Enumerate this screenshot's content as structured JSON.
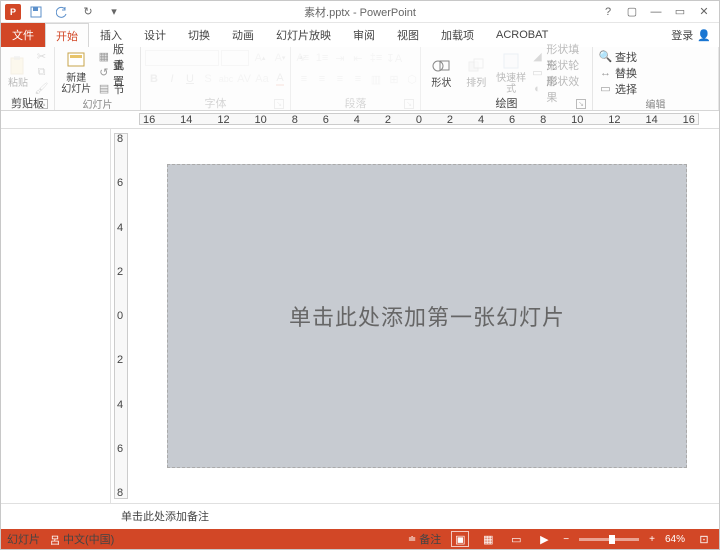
{
  "titlebar": {
    "title": "素材.pptx - PowerPoint"
  },
  "tabs": {
    "file": "文件",
    "items": [
      "开始",
      "插入",
      "设计",
      "切换",
      "动画",
      "幻灯片放映",
      "审阅",
      "视图",
      "加载项",
      "ACROBAT"
    ],
    "active": 0,
    "login": "登录"
  },
  "ribbon": {
    "clipboard": {
      "paste": "粘贴",
      "format": "格式刷",
      "label": "剪贴板"
    },
    "slides": {
      "new": "新建\n幻灯片",
      "layout": "版式",
      "reset": "重置",
      "section": "节",
      "label": "幻灯片"
    },
    "font": {
      "label": "字体"
    },
    "paragraph": {
      "label": "段落"
    },
    "drawing": {
      "shapes": "形状",
      "arrange": "排列",
      "quickstyle": "快速样式",
      "fill": "形状填充",
      "outline": "形状轮廓",
      "effects": "形状效果",
      "label": "绘图"
    },
    "editing": {
      "find": "查找",
      "replace": "替换",
      "select": "选择",
      "label": "编辑"
    }
  },
  "ruler": {
    "h": [
      "16",
      "14",
      "12",
      "10",
      "8",
      "6",
      "4",
      "2",
      "0",
      "2",
      "4",
      "6",
      "8",
      "10",
      "12",
      "14",
      "16"
    ],
    "v": [
      "8",
      "6",
      "4",
      "2",
      "0",
      "2",
      "4",
      "6",
      "8"
    ]
  },
  "slide": {
    "placeholder": "单击此处添加第一张幻灯片"
  },
  "notes": {
    "placeholder": "单击此处添加备注"
  },
  "status": {
    "slide": "幻灯片",
    "lang": "中文(中国)",
    "notes": "备注",
    "zoom": "64%"
  }
}
